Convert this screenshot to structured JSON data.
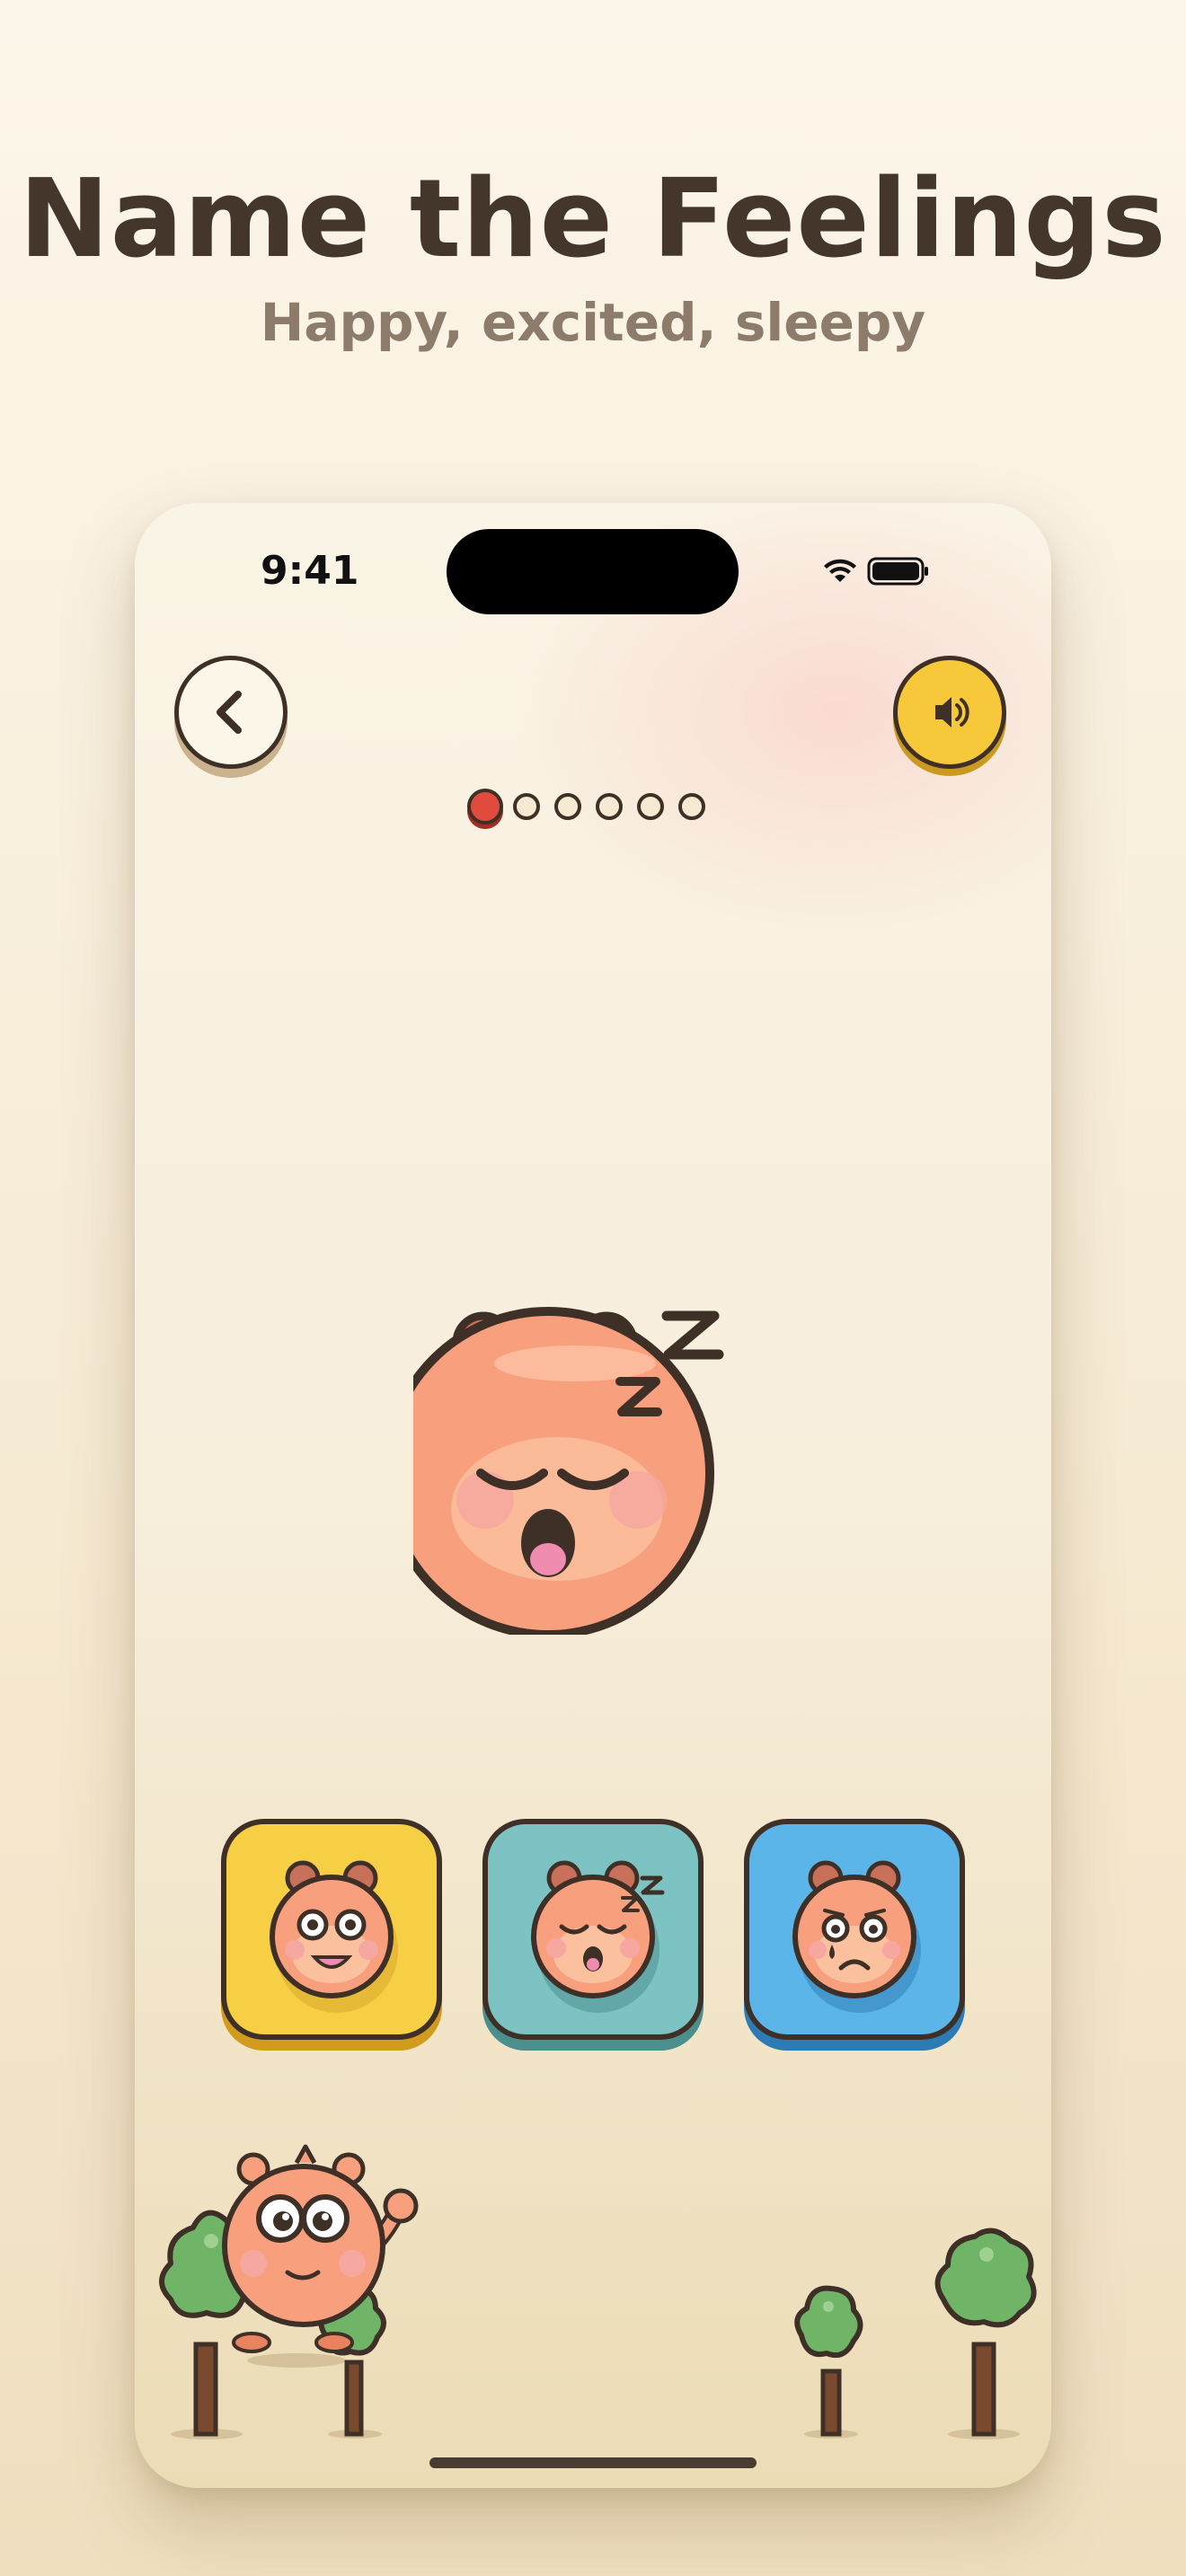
{
  "header": {
    "title": "Name the Feelings",
    "subtitle": "Happy, excited, sleepy"
  },
  "status_bar": {
    "time": "9:41",
    "icons": [
      "wifi-icon",
      "battery-icon"
    ]
  },
  "toolbar": {
    "back_icon": "chevron-left-icon",
    "sound_icon": "speaker-icon"
  },
  "progress": {
    "total_steps": 6,
    "current_step": 1
  },
  "prompt_face": {
    "emotion": "sleepy",
    "icon": "sleepy-face-icon"
  },
  "choices": [
    {
      "emotion": "happy",
      "icon": "happy-face-icon",
      "color": "#f6cf45"
    },
    {
      "emotion": "sleepy",
      "icon": "sleepy-face-icon",
      "color": "#7dc3c3"
    },
    {
      "emotion": "sad",
      "icon": "sad-face-icon",
      "color": "#5bb5e9"
    }
  ],
  "colors": {
    "title": "#45362b",
    "subtitle": "#8d7b6c",
    "character": "#f8a07d",
    "outline": "#3e3027",
    "progress_active": "#e14a3d",
    "sound_button": "#f7c93a"
  }
}
